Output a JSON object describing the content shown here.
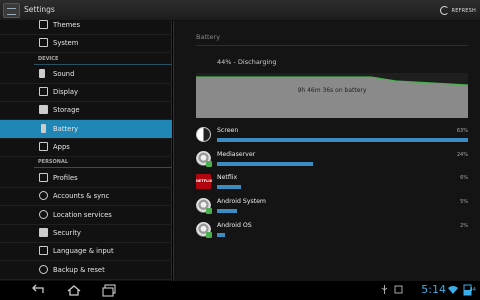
{
  "action_bar": {
    "title": "Settings",
    "refresh_label": "REFRESH"
  },
  "sidebar": {
    "items": [
      {
        "label": "Themes"
      },
      {
        "label": "System"
      },
      {
        "header": "DEVICE"
      },
      {
        "label": "Sound"
      },
      {
        "label": "Display"
      },
      {
        "label": "Storage"
      },
      {
        "label": "Battery"
      },
      {
        "label": "Apps"
      },
      {
        "header": "PERSONAL"
      },
      {
        "label": "Profiles"
      },
      {
        "label": "Accounts & sync"
      },
      {
        "label": "Location services"
      },
      {
        "label": "Security"
      },
      {
        "label": "Language & input"
      },
      {
        "label": "Backup & reset"
      }
    ],
    "selected": "Battery"
  },
  "battery": {
    "title": "Battery",
    "status": "44% - Discharging",
    "graph_label": "9h 46m 36s on battery",
    "usage": [
      {
        "name": "Screen",
        "percent_label": "63%",
        "value": 63,
        "icon": "screen-icon"
      },
      {
        "name": "Mediaserver",
        "percent_label": "24%",
        "value": 24,
        "icon": "android-app-icon"
      },
      {
        "name": "Netflix",
        "percent_label": "6%",
        "value": 6,
        "icon": "netflix-icon",
        "icon_text": "NETFLIX"
      },
      {
        "name": "Android System",
        "percent_label": "5%",
        "value": 5,
        "icon": "android-app-icon"
      },
      {
        "name": "Android OS",
        "percent_label": "2%",
        "value": 2,
        "icon": "android-app-icon"
      }
    ]
  },
  "status_bar": {
    "time": "5:14",
    "battery_level": "44"
  },
  "colors": {
    "accent": "#1f86b6",
    "bar": "#3a8cc2",
    "graph_fill": "#8a8a8a",
    "graph_line": "#4caf50",
    "clock": "#3aaee8"
  }
}
